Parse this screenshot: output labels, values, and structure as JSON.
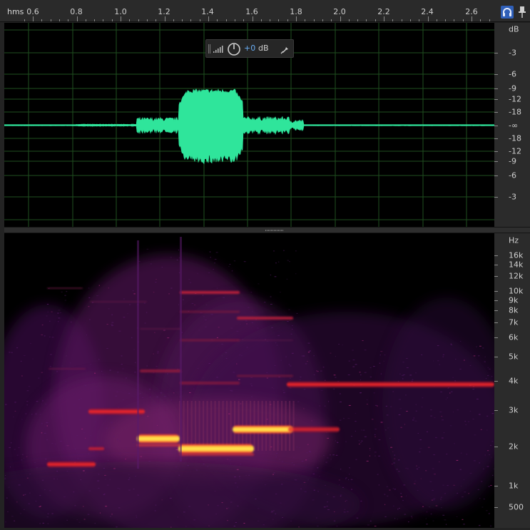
{
  "time_ruler": {
    "unit_label": "hms",
    "labels": [
      "0.6",
      "0.8",
      "1.0",
      "1.2",
      "1.4",
      "1.6",
      "1.8",
      "2.0",
      "2.2",
      "2.4",
      "2.6"
    ]
  },
  "toolbar": {
    "headphone_icon": "headphones-icon",
    "pin_icon": "pin-icon"
  },
  "hud": {
    "value": "+0",
    "unit": "dB",
    "icons": [
      "drag-handle-icon",
      "level-meter-icon",
      "volume-knob-icon",
      "pin-icon"
    ]
  },
  "amplitude_scale": {
    "labels": [
      "dB",
      "-3",
      "-6",
      "-9",
      "-12",
      "-18",
      "-∞",
      "-18",
      "-12",
      "-9",
      "-6",
      "-3"
    ]
  },
  "frequency_scale": {
    "labels": [
      "Hz",
      "16k",
      "14k",
      "12k",
      "10k",
      "9k",
      "8k",
      "7k",
      "6k",
      "5k",
      "4k",
      "3k",
      "2k",
      "1k",
      "500"
    ]
  },
  "colors": {
    "waveform": "#2fe59b",
    "grid": "#1f4f1f",
    "spectral_hot": "#ffe34a",
    "spectral_mid": "#ff2020",
    "spectral_low": "#6a1a7a",
    "hud_accent": "#6aaef5"
  }
}
